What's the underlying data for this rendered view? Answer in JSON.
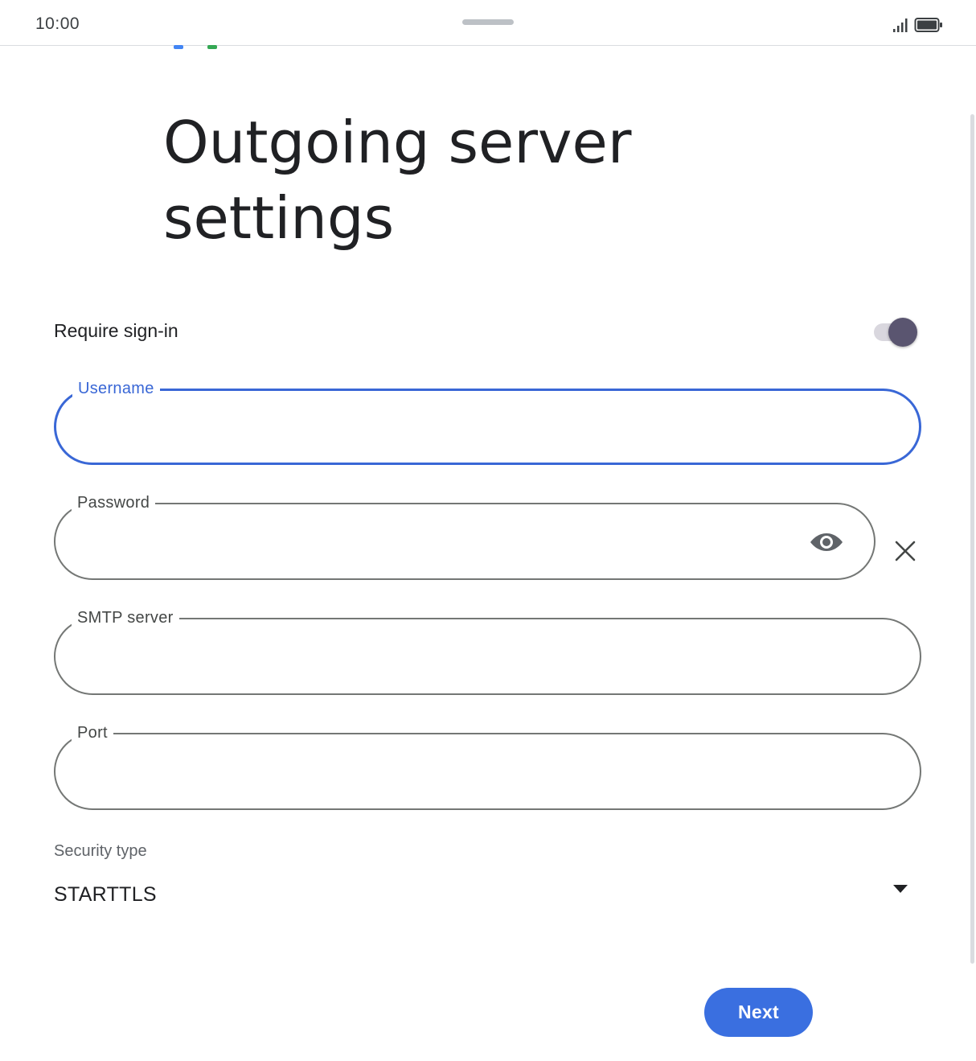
{
  "status_bar": {
    "time": "10:00",
    "signal_icon": "cell-signal-icon",
    "battery_icon": "battery-full-icon"
  },
  "page": {
    "title": "Outgoing server settings"
  },
  "require_sign_in": {
    "label": "Require sign-in",
    "enabled": true
  },
  "fields": {
    "username": {
      "label": "Username",
      "value": ""
    },
    "password": {
      "label": "Password",
      "value": "",
      "visibility_icon": "eye-icon",
      "clear_icon": "close-icon"
    },
    "smtp_server": {
      "label": "SMTP server",
      "value": ""
    },
    "port": {
      "label": "Port",
      "value": ""
    }
  },
  "security": {
    "label": "Security type",
    "selected": "STARTTLS",
    "arrow_icon": "dropdown-arrow-icon"
  },
  "actions": {
    "next_label": "Next"
  },
  "colors": {
    "accent": "#3a6fe0",
    "focus_outline": "#3967d6",
    "toggle_thumb": "#5a5570",
    "toggle_track": "#d9d7de",
    "outline": "#747775"
  }
}
